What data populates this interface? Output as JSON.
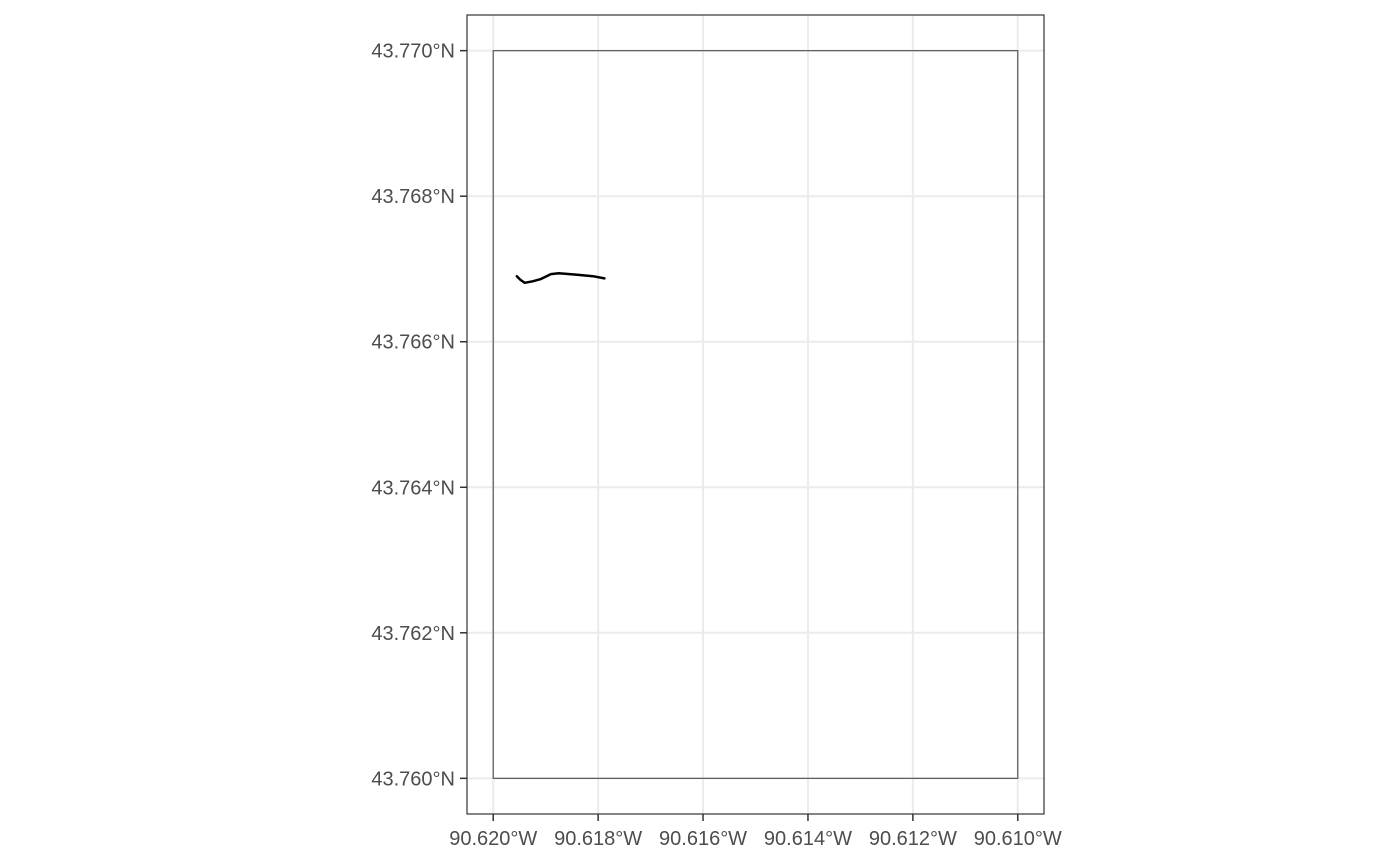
{
  "chart_data": {
    "type": "map",
    "title": "",
    "xlabel": "",
    "ylabel": "",
    "xlim": [
      -90.6205,
      -90.6095
    ],
    "ylim": [
      43.75951,
      43.77049
    ],
    "x_ticks": [
      {
        "value": -90.62,
        "label": "90.620°W"
      },
      {
        "value": -90.618,
        "label": "90.618°W"
      },
      {
        "value": -90.616,
        "label": "90.616°W"
      },
      {
        "value": -90.614,
        "label": "90.614°W"
      },
      {
        "value": -90.612,
        "label": "90.612°W"
      },
      {
        "value": -90.61,
        "label": "90.610°W"
      }
    ],
    "y_ticks": [
      {
        "value": 43.76,
        "label": "43.760°N"
      },
      {
        "value": 43.762,
        "label": "43.762°N"
      },
      {
        "value": 43.764,
        "label": "43.764°N"
      },
      {
        "value": 43.766,
        "label": "43.766°N"
      },
      {
        "value": 43.768,
        "label": "43.768°N"
      },
      {
        "value": 43.77,
        "label": "43.770°N"
      }
    ],
    "grid": true,
    "bounding_box": {
      "xmin": -90.62,
      "xmax": -90.61,
      "ymin": 43.76,
      "ymax": 43.77,
      "stroke_color": "#595959"
    },
    "line_feature": {
      "color": "#000000",
      "points": [
        [
          -90.61955,
          43.7669
        ],
        [
          -90.61948,
          43.76685
        ],
        [
          -90.6194,
          43.76681
        ],
        [
          -90.61925,
          43.76683
        ],
        [
          -90.6191,
          43.76686
        ],
        [
          -90.6189,
          43.76693
        ],
        [
          -90.61875,
          43.76694
        ],
        [
          -90.6184,
          43.76692
        ],
        [
          -90.6181,
          43.7669
        ],
        [
          -90.61788,
          43.76687
        ]
      ]
    },
    "colors": {
      "panel_border": "#333333",
      "grid": "#ebebeb",
      "tick_label": "#4d4d4d",
      "background": "#ffffff"
    }
  }
}
